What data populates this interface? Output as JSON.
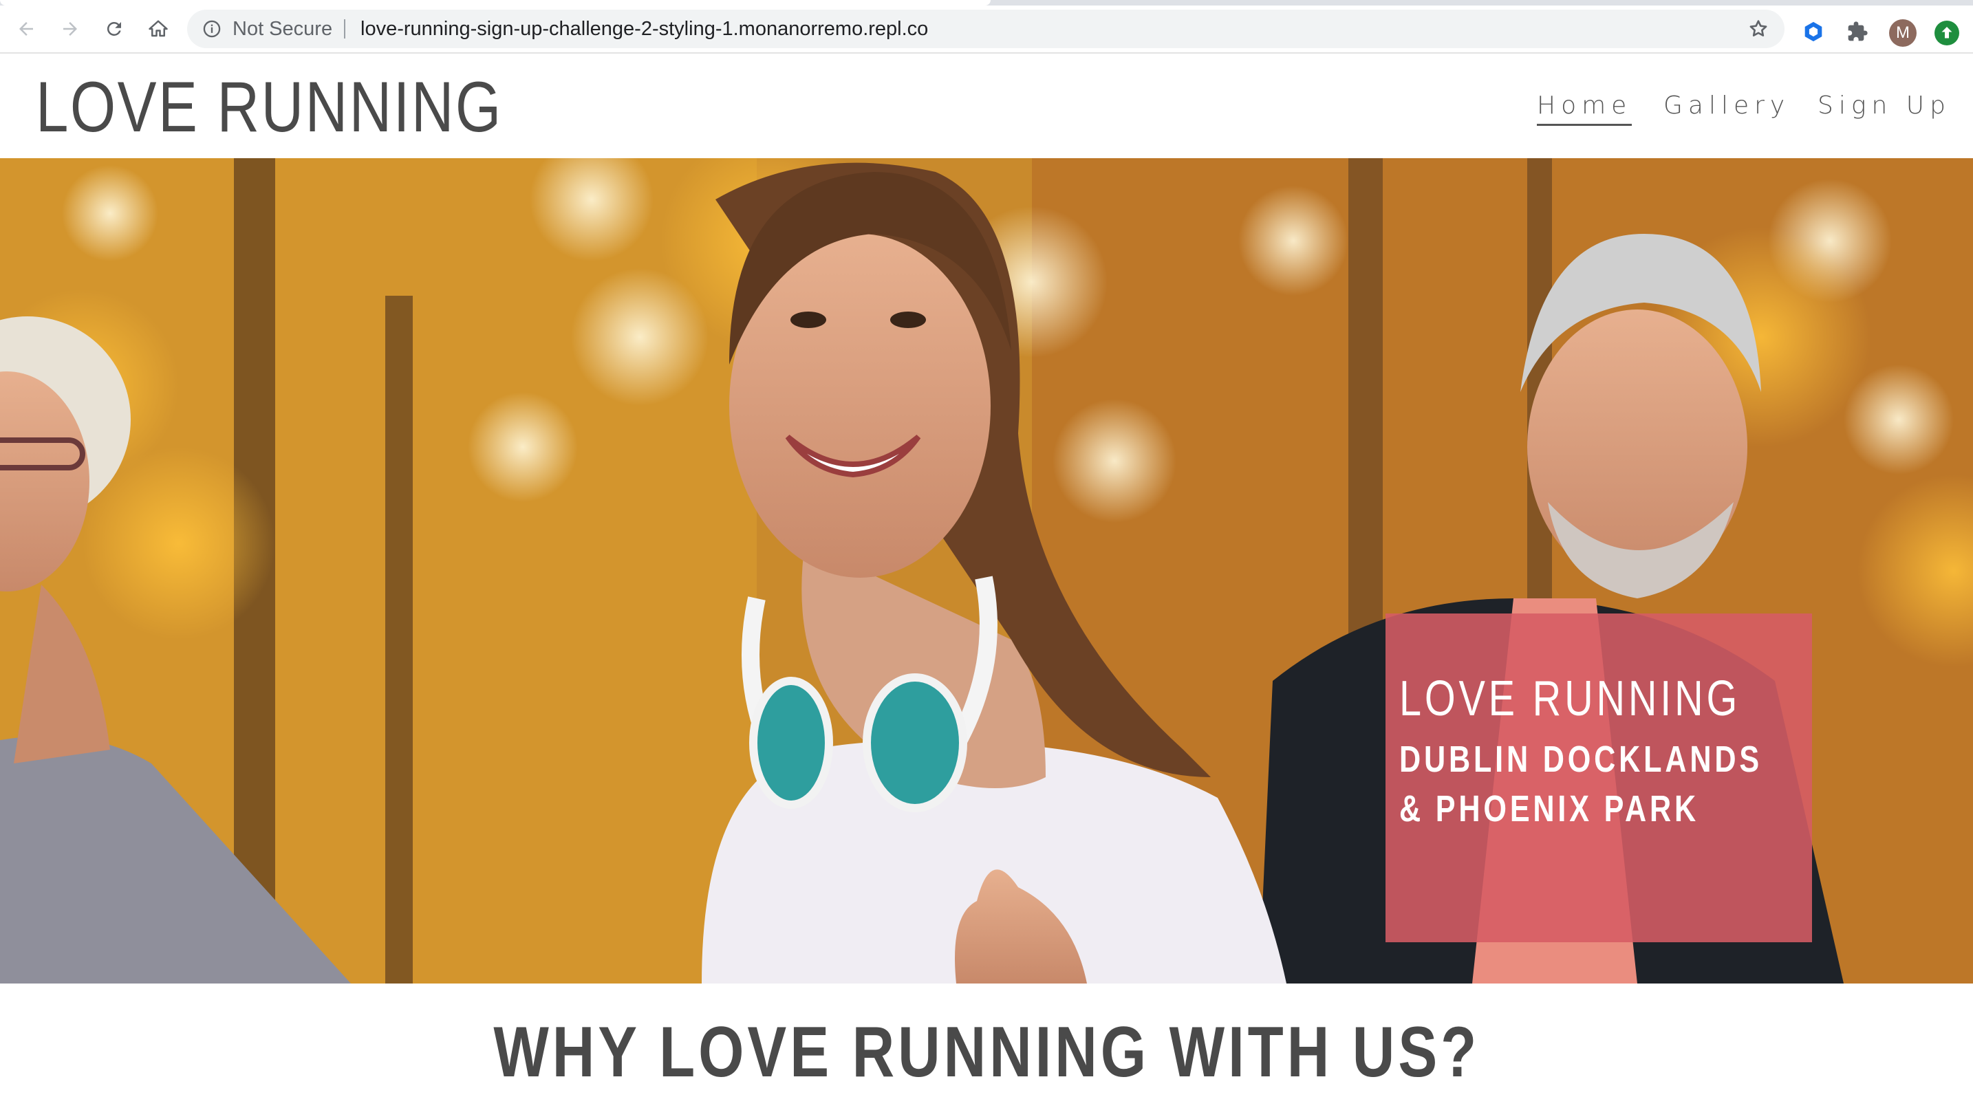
{
  "browser": {
    "security_label": "Not Secure",
    "url": "love-running-sign-up-challenge-2-styling-1.monanorremo.repl.co",
    "profile_initial": "M",
    "toolbar_icons": [
      "back-arrow-icon",
      "forward-arrow-icon",
      "reload-icon",
      "home-icon",
      "info-icon",
      "bookmark-star-icon",
      "extension-hexagon-icon",
      "extensions-puzzle-icon",
      "update-arrow-icon"
    ]
  },
  "header": {
    "logo": "LOVE RUNNING",
    "nav": [
      {
        "label": "Home",
        "active": true
      },
      {
        "label": "Gallery",
        "active": false
      },
      {
        "label": "Sign Up",
        "active": false
      }
    ]
  },
  "hero": {
    "card_title": "LOVE RUNNING",
    "card_subtitle": "DUBLIN DOCKLANDS & PHOENIX PARK",
    "card_color": "#d65c64"
  },
  "section": {
    "heading": "WHY LOVE RUNNING WITH US?"
  },
  "colors": {
    "text_dark": "#4a4a4a",
    "omnibox_bg": "#f1f3f4"
  }
}
